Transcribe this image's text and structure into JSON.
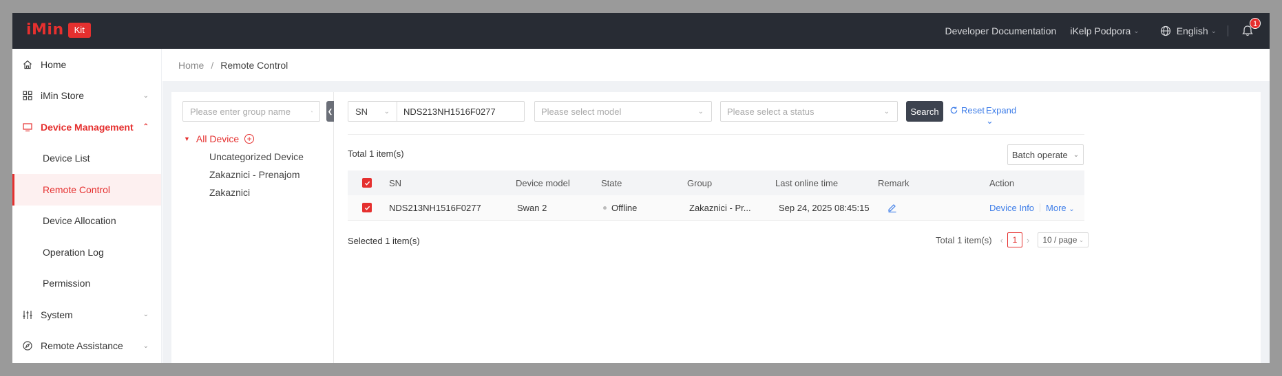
{
  "colors": {
    "brand": "#e5302f",
    "header_bg": "#282c34",
    "link": "#3c7ce8",
    "search_btn": "#3d434f"
  },
  "header": {
    "logo_text": "iMin",
    "logo_badge": "Kit",
    "docs_link": "Developer Documentation",
    "user_name": "iKelp Podpora",
    "language": "English",
    "notification_count": "1"
  },
  "sidebar": {
    "items": [
      {
        "label": "Home",
        "icon": "home-icon"
      },
      {
        "label": "iMin Store",
        "icon": "grid-icon"
      },
      {
        "label": "Device Management",
        "icon": "monitor-icon"
      },
      {
        "label": "Device List"
      },
      {
        "label": "Remote Control"
      },
      {
        "label": "Device Allocation"
      },
      {
        "label": "Operation Log"
      },
      {
        "label": "Permission"
      },
      {
        "label": "System",
        "icon": "sliders-icon"
      },
      {
        "label": "Remote Assistance",
        "icon": "compass-icon"
      }
    ]
  },
  "breadcrumb": {
    "home": "Home",
    "separator": "/",
    "current": "Remote Control"
  },
  "groups": {
    "search_placeholder": "Please enter group name",
    "root": "All Device",
    "children": [
      "Uncategorized Device",
      "Zakaznici - Prenajom",
      "Zakaznici"
    ]
  },
  "filters": {
    "field": "SN",
    "sn_value": "NDS213NH1516F0277",
    "model_placeholder": "Please select model",
    "status_placeholder": "Please select a status",
    "search_label": "Search",
    "reset_label": "Reset",
    "expand_label": "Expand"
  },
  "summary": {
    "total_top": "Total 1 item(s)",
    "batch_label": "Batch operate",
    "selected": "Selected 1 item(s)"
  },
  "table": {
    "columns": [
      "SN",
      "Device model",
      "State",
      "Group",
      "Last online time",
      "Remark",
      "Action"
    ],
    "rows": [
      {
        "sn": "NDS213NH1516F0277",
        "model": "Swan 2",
        "state": "Offline",
        "group": "Zakaznici - Pr...",
        "last_online": "Sep 24, 2025 08:45:15",
        "action_info": "Device Info",
        "action_more": "More"
      }
    ]
  },
  "pagination": {
    "total": "Total 1 item(s)",
    "current_page": "1",
    "page_size": "10 / page"
  }
}
